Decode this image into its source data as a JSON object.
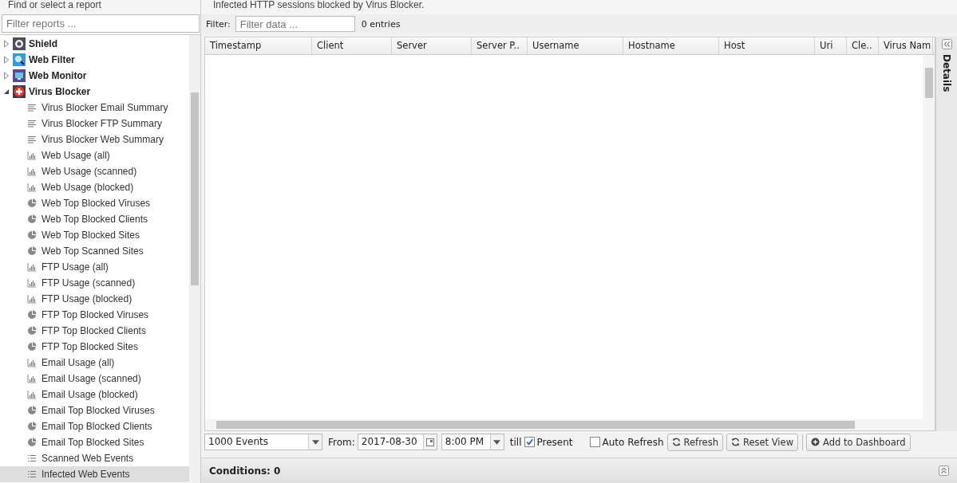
{
  "sidebar": {
    "title": "Find or select a report",
    "filter_placeholder": "Filter reports ...",
    "tree": [
      {
        "label": "Shield",
        "kind": "shield",
        "expanded": false
      },
      {
        "label": "Web Filter",
        "kind": "search",
        "expanded": false
      },
      {
        "label": "Web Monitor",
        "kind": "monitor",
        "expanded": false
      },
      {
        "label": "Virus Blocker",
        "kind": "cross",
        "expanded": true,
        "children": [
          {
            "label": "Virus Blocker Email Summary",
            "kind": "text",
            "selected": false
          },
          {
            "label": "Virus Blocker FTP Summary",
            "kind": "text",
            "selected": false
          },
          {
            "label": "Virus Blocker Web Summary",
            "kind": "text",
            "selected": false
          },
          {
            "label": "Web Usage (all)",
            "kind": "bar",
            "selected": false
          },
          {
            "label": "Web Usage (scanned)",
            "kind": "bar",
            "selected": false
          },
          {
            "label": "Web Usage (blocked)",
            "kind": "bar",
            "selected": false
          },
          {
            "label": "Web Top Blocked Viruses",
            "kind": "pie",
            "selected": false
          },
          {
            "label": "Web Top Blocked Clients",
            "kind": "pie",
            "selected": false
          },
          {
            "label": "Web Top Blocked Sites",
            "kind": "pie",
            "selected": false
          },
          {
            "label": "Web Top Scanned Sites",
            "kind": "pie",
            "selected": false
          },
          {
            "label": "FTP Usage (all)",
            "kind": "bar",
            "selected": false
          },
          {
            "label": "FTP Usage (scanned)",
            "kind": "bar",
            "selected": false
          },
          {
            "label": "FTP Usage (blocked)",
            "kind": "bar",
            "selected": false
          },
          {
            "label": "FTP Top Blocked Viruses",
            "kind": "pie",
            "selected": false
          },
          {
            "label": "FTP Top Blocked Clients",
            "kind": "pie",
            "selected": false
          },
          {
            "label": "FTP Top Blocked Sites",
            "kind": "pie",
            "selected": false
          },
          {
            "label": "Email Usage (all)",
            "kind": "bar",
            "selected": false
          },
          {
            "label": "Email Usage (scanned)",
            "kind": "bar",
            "selected": false
          },
          {
            "label": "Email Usage (blocked)",
            "kind": "bar",
            "selected": false
          },
          {
            "label": "Email Top Blocked Viruses",
            "kind": "pie",
            "selected": false
          },
          {
            "label": "Email Top Blocked Clients",
            "kind": "pie",
            "selected": false
          },
          {
            "label": "Email Top Blocked Sites",
            "kind": "pie",
            "selected": false
          },
          {
            "label": "Scanned Web Events",
            "kind": "list",
            "selected": false
          },
          {
            "label": "Infected Web Events",
            "kind": "list",
            "selected": true
          }
        ]
      }
    ]
  },
  "description": "Infected HTTP sessions blocked by Virus Blocker.",
  "filter": {
    "label": "Filter:",
    "placeholder": "Filter data ...",
    "count": "0 entries"
  },
  "table": {
    "columns": [
      "Timestamp",
      "Client",
      "Server",
      "Server P..",
      "Username",
      "Hostname",
      "Host",
      "Uri",
      "Cle..",
      "Virus Nam"
    ]
  },
  "details_label": "Details",
  "toolbar": {
    "limit": "1000 Events",
    "from_label": "From:",
    "date": "2017-08-30",
    "time": "8:00 PM",
    "till_label": "till",
    "present": {
      "label": "Present",
      "checked": true
    },
    "auto_refresh": {
      "label": "Auto Refresh",
      "checked": false
    },
    "buttons": [
      {
        "label": "Refresh",
        "kind": "refresh"
      },
      {
        "label": "Reset View",
        "kind": "refresh"
      },
      {
        "label": "Add to Dashboard",
        "kind": "add"
      }
    ]
  },
  "conditions": "Conditions: 0"
}
